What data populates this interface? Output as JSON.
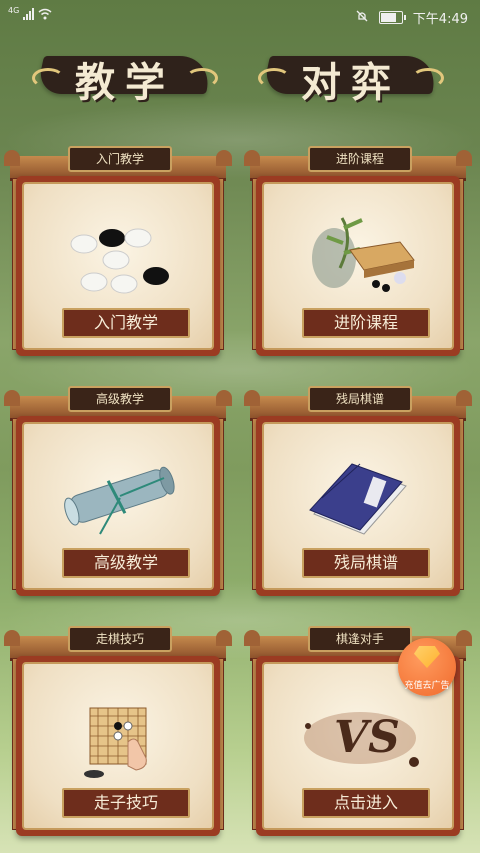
{
  "status_bar": {
    "network": "4G",
    "time": "下午4:49"
  },
  "headers": {
    "teaching": "教学",
    "battle": "对弈"
  },
  "cards": [
    {
      "tag": "入门教学",
      "label": "入门教学",
      "icon": "go-stones-icon"
    },
    {
      "tag": "进阶课程",
      "label": "进阶课程",
      "icon": "go-board-icon"
    },
    {
      "tag": "高级教学",
      "label": "高级教学",
      "icon": "scroll-icon"
    },
    {
      "tag": "残局棋谱",
      "label": "残局棋谱",
      "icon": "book-icon"
    },
    {
      "tag": "走棋技巧",
      "label": "走子技巧",
      "icon": "hand-board-icon"
    },
    {
      "tag": "棋逢对手",
      "label": "点击进入",
      "icon": "vs-icon"
    }
  ],
  "ad_badge": {
    "label": "充值去广告"
  },
  "colors": {
    "accent": "#6e2d1c",
    "frame": "#9b3b22",
    "gold": "#c9a160"
  }
}
